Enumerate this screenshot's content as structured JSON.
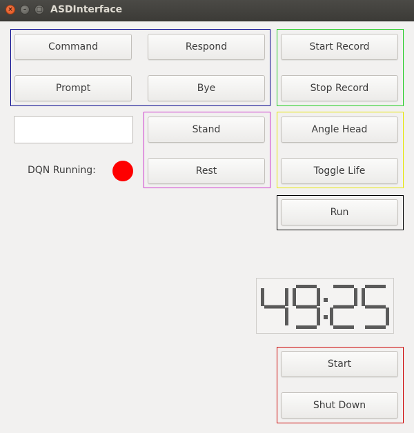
{
  "window": {
    "title": "ASDInterface",
    "controls": {
      "close": "×",
      "minimize": "–",
      "maximize": "□"
    }
  },
  "buttons": {
    "command": "Command",
    "respond": "Respond",
    "prompt": "Prompt",
    "bye": "Bye",
    "start_record": "Start Record",
    "stop_record": "Stop Record",
    "stand": "Stand",
    "rest": "Rest",
    "angle_head": "Angle Head",
    "toggle_life": "Toggle Life",
    "run": "Run",
    "start": "Start",
    "shut_down": "Shut Down"
  },
  "text_input": {
    "value": ""
  },
  "dqn_status": {
    "label": "DQN Running:",
    "indicator_color": "#fe0000"
  },
  "timer": {
    "display": "49:25"
  },
  "group_colors": {
    "dialogue": "#00008b",
    "recording": "#22cc22",
    "posture": "#cc33cc",
    "head": "#e5e500",
    "run": "#000000",
    "power": "#cc0000"
  }
}
